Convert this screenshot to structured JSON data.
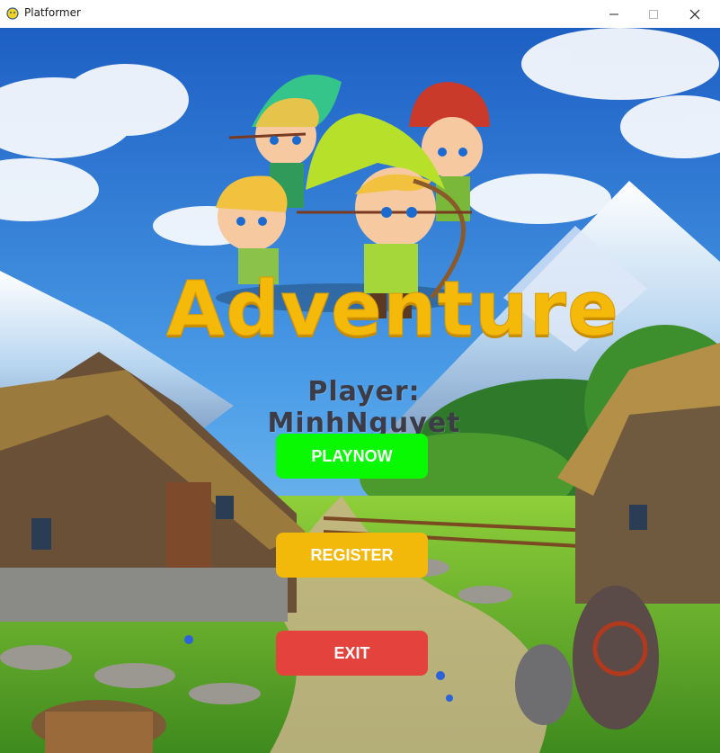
{
  "window": {
    "title": "Platformer",
    "icon": "pygame-snake-icon",
    "controls": {
      "minimize_icon": "minimize-icon",
      "maximize_icon": "maximize-icon",
      "close_icon": "close-icon"
    }
  },
  "game": {
    "title": "Adventure",
    "player_label": "Player: MinhNguyet",
    "buttons": {
      "play": "PLAYNOW",
      "register": "REGISTER",
      "exit": "EXIT"
    }
  },
  "colors": {
    "title": "#f5b90a",
    "player_text": "#3c3b46",
    "play_button": "#08f902",
    "register_button": "#f2b90b",
    "exit_button": "#e4433d"
  }
}
